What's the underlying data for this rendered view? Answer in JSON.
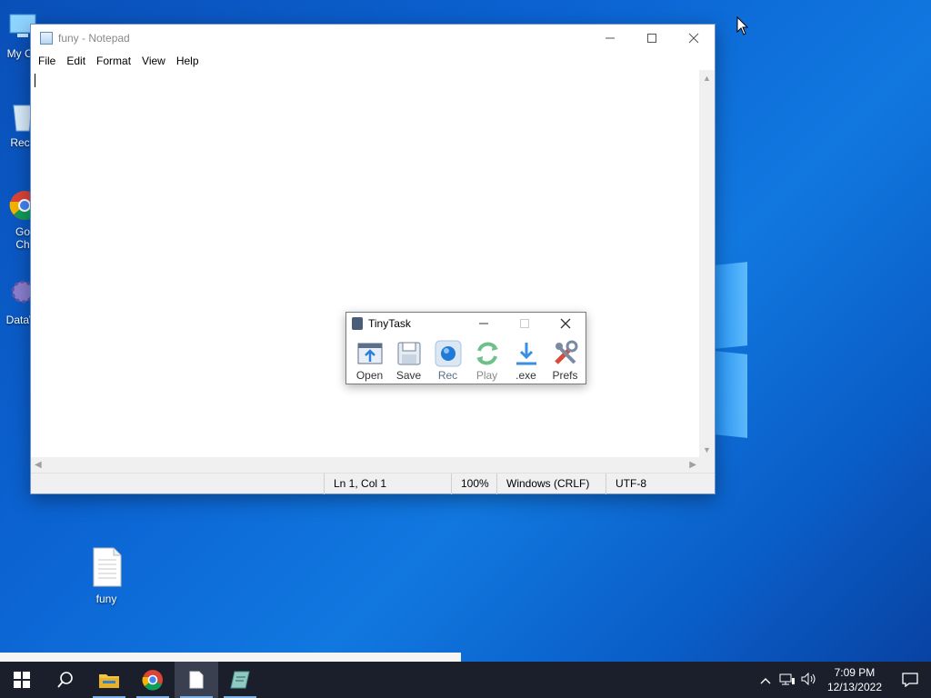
{
  "desktop": {
    "icons": [
      {
        "label": "My Co"
      },
      {
        "label": "Recy"
      },
      {
        "label": "Go\nCh"
      },
      {
        "label": "DataW"
      },
      {
        "label": "funy"
      }
    ]
  },
  "notepad": {
    "title": "funy - Notepad",
    "menu": [
      "File",
      "Edit",
      "Format",
      "View",
      "Help"
    ],
    "status": {
      "position": "Ln 1, Col 1",
      "zoom": "100%",
      "line_ending": "Windows (CRLF)",
      "encoding": "UTF-8"
    },
    "content": ""
  },
  "tinytask": {
    "title": "TinyTask",
    "buttons": [
      {
        "label": "Open",
        "icon": "open-icon"
      },
      {
        "label": "Save",
        "icon": "save-icon"
      },
      {
        "label": "Rec",
        "icon": "record-icon"
      },
      {
        "label": "Play",
        "icon": "play-icon"
      },
      {
        "label": ".exe",
        "icon": "compile-exe-icon"
      },
      {
        "label": "Prefs",
        "icon": "prefs-icon"
      }
    ]
  },
  "taskbar": {
    "apps": [
      "start",
      "search",
      "file-explorer",
      "chrome",
      "notepad",
      "tinytask"
    ],
    "clock_time": "7:09 PM",
    "clock_date": "12/13/2022"
  },
  "colors": {
    "desktop_blue": "#0b63d2",
    "taskbar": "#1a1f2b",
    "active_underline": "#7fb3e8"
  }
}
